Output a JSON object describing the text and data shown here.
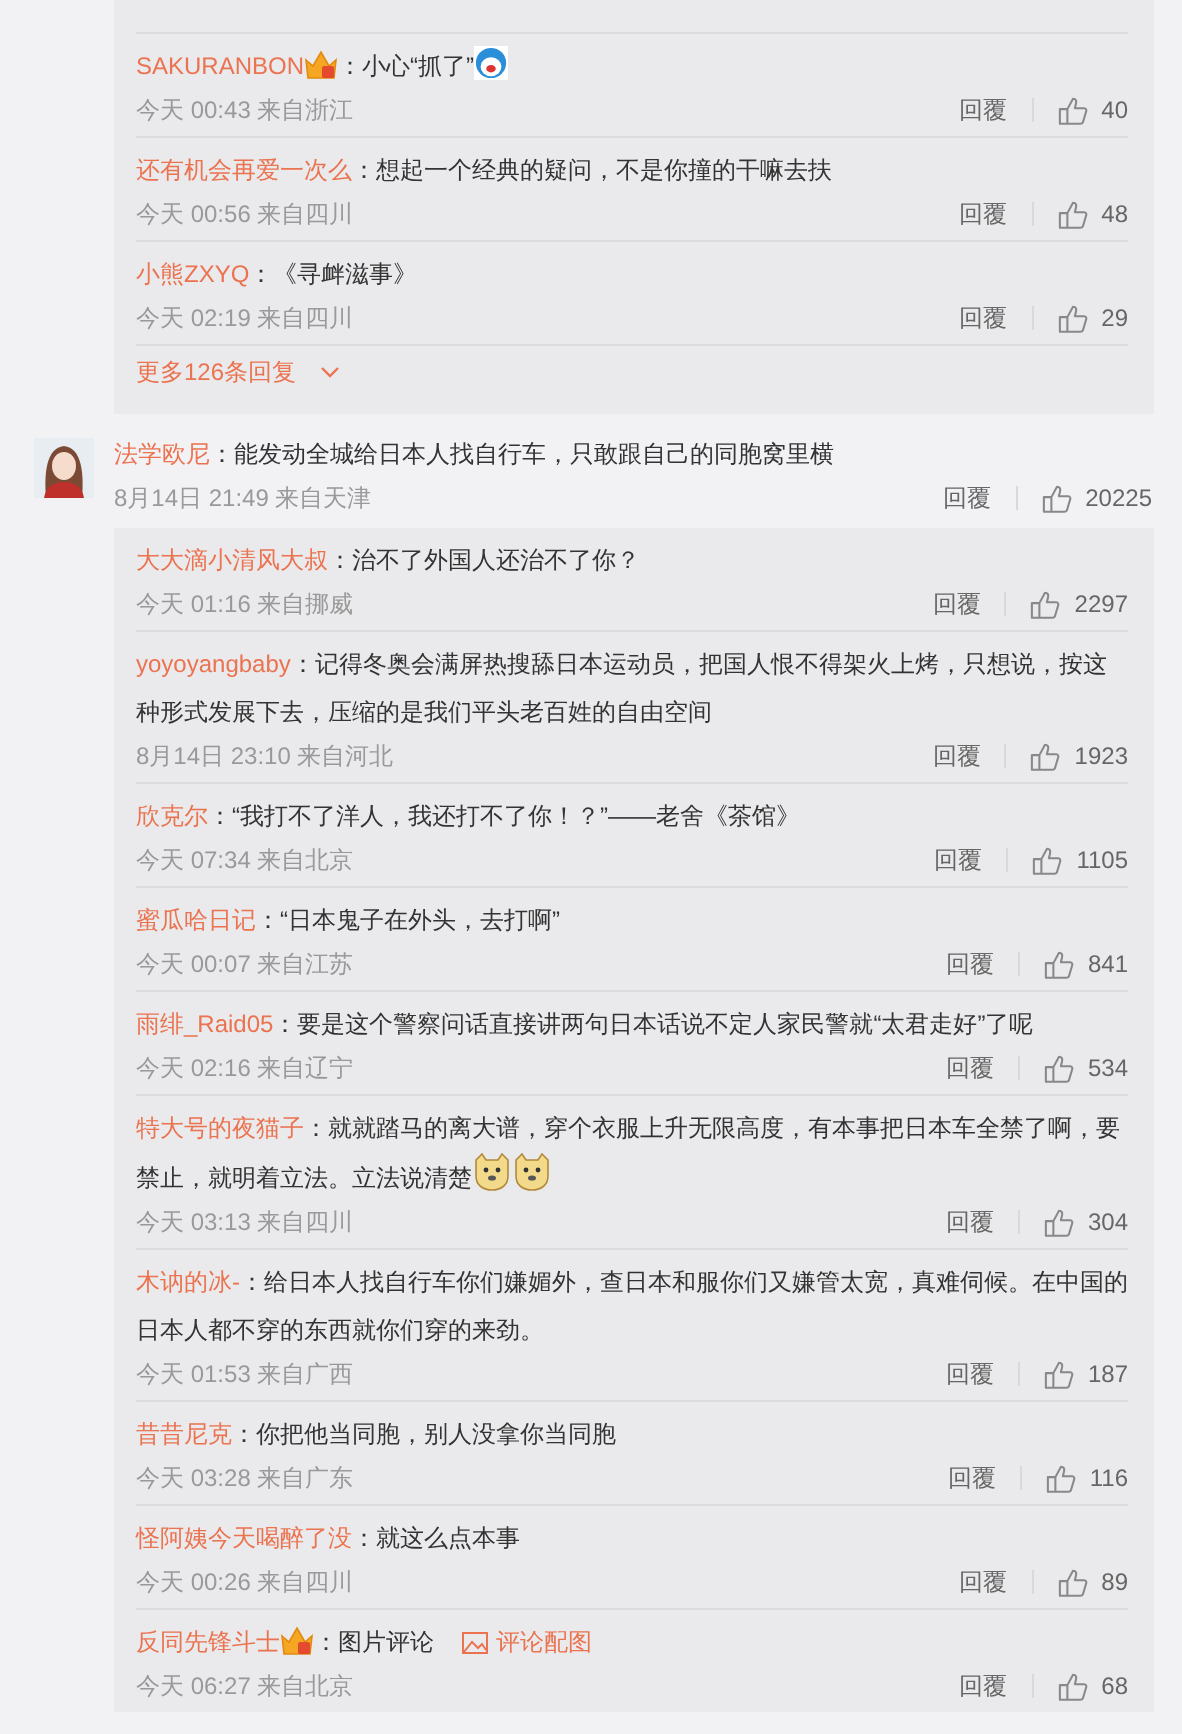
{
  "thread_top": {
    "replies": [
      {
        "user": "SAKURANBON",
        "badge": true,
        "text": "：小心“抓了”",
        "emoji": [
          {
            "kind": "sticker"
          }
        ],
        "meta": "今天 00:43 来自浙江",
        "reply": "回覆",
        "likes": "40"
      },
      {
        "user": "还有机会再爱一次么",
        "badge": false,
        "text": "：想起一个经典的疑问，不是你撞的干嘛去扶",
        "meta": "今天 00:56 来自四川",
        "reply": "回覆",
        "likes": "48"
      },
      {
        "user": "小熊ZXYQ",
        "badge": false,
        "text": "：《寻衅滋事》",
        "meta": "今天 02:19 来自四川",
        "reply": "回覆",
        "likes": "29"
      }
    ],
    "more": "更多126条回复"
  },
  "comment": {
    "user": "法学欧尼",
    "text": "：能发动全城给日本人找自行车，只敢跟自己的同胞窝里横",
    "meta": "8月14日 21:49 来自天津",
    "reply": "回覆",
    "likes": "20225",
    "replies": [
      {
        "user": "大大滴小清风大叔",
        "badge": false,
        "text": "：治不了外国人还治不了你？",
        "meta": "今天 01:16 来自挪威",
        "reply": "回覆",
        "likes": "2297"
      },
      {
        "user": "yoyoyangbaby",
        "badge": false,
        "text": "：记得冬奥会满屏热搜舔日本运动员，把国人恨不得架火上烤，只想说，按这种形式发展下去，压缩的是我们平头老百姓的自由空间",
        "meta": "8月14日 23:10 来自河北",
        "reply": "回覆",
        "likes": "1923"
      },
      {
        "user": "欣克尔",
        "badge": false,
        "text": "：“我打不了洋人，我还打不了你！？”——老舍《茶馆》",
        "meta": "今天 07:34 来自北京",
        "reply": "回覆",
        "likes": "1105"
      },
      {
        "user": "蜜瓜哈日记",
        "badge": false,
        "text": "：“日本鬼子在外头，去打啊”",
        "meta": "今天 00:07 来自江苏",
        "reply": "回覆",
        "likes": "841"
      },
      {
        "user": "雨绯_Raid05",
        "badge": false,
        "text": "：要是这个警察问话直接讲两句日本话说不定人家民警就“太君走好”了呢",
        "meta": "今天 02:16 来自辽宁",
        "reply": "回覆",
        "likes": "534"
      },
      {
        "user": "特大号的夜猫子",
        "badge": false,
        "text": "：就就踏马的离大谱，穿个衣服上升无限高度，有本事把日本车全禁了啊，要禁止，就明着立法。立法说清楚",
        "emoji": [
          {
            "kind": "dog"
          },
          {
            "kind": "dog"
          }
        ],
        "meta": "今天 03:13 来自四川",
        "reply": "回覆",
        "likes": "304"
      },
      {
        "user": "木讷的冰-",
        "badge": false,
        "text": "：给日本人找自行车你们嫌媚外，查日本和服你们又嫌管太宽，真难伺候。在中国的日本人都不穿的东西就你们穿的来劲。",
        "meta": "今天 01:53 来自广西",
        "reply": "回覆",
        "likes": "187"
      },
      {
        "user": "昔昔尼克",
        "badge": false,
        "text": "：你把他当同胞，别人没拿你当同胞",
        "meta": "今天 03:28 来自广东",
        "reply": "回覆",
        "likes": "116"
      },
      {
        "user": "怪阿姨今天喝醉了没",
        "badge": false,
        "text": "：就这么点本事",
        "meta": "今天 00:26 来自四川",
        "reply": "回覆",
        "likes": "89"
      },
      {
        "user": "反同先锋斗士",
        "badge": true,
        "text": "：图片评论",
        "image_link": "评论配图",
        "meta": "今天 06:27 来自北京",
        "reply": "回覆",
        "likes": "68"
      }
    ]
  }
}
